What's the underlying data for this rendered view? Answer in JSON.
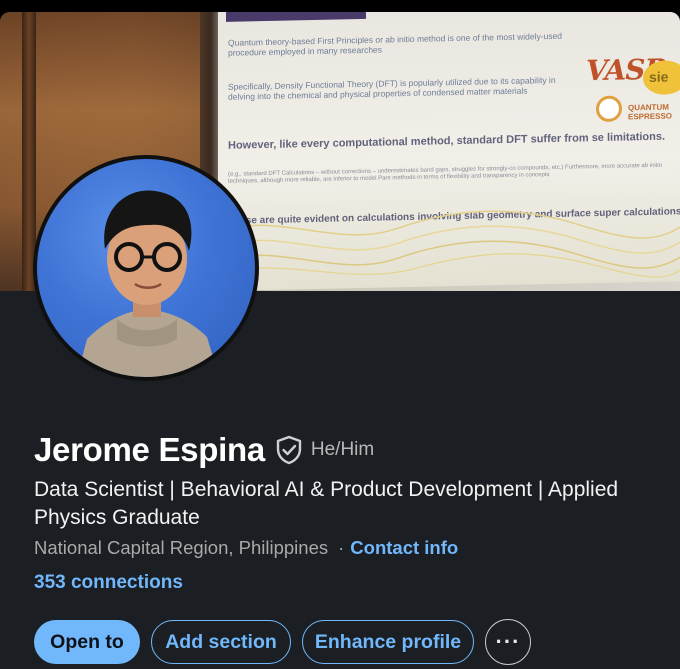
{
  "profile": {
    "name": "Jerome Espina",
    "pronouns": "He/Him",
    "headline": "Data Scientist | Behavioral AI & Product Development | Applied Physics Graduate",
    "location": "National Capital Region, Philippines",
    "separator": "·",
    "contact_info_label": "Contact info",
    "connections_label": "353 connections"
  },
  "banner_slide": {
    "line1": "Quantum theory-based First Principles or ab initio method is one of the most widely-used procedure employed in many researches",
    "line2": "Specifically, Density Functional Theory (DFT) is popularly utilized due to its capability in delving into the chemical and physical properties of condensed matter materials",
    "line3": "However, like every computational method, standard DFT suffer from se limitations.",
    "line4": "(e.g., standard DFT Calculations – without corrections – underestimates band gaps, struggles for strongly-co compounds, etc.) Furthermore, more accurate ab initio techniques, although more reliable, are inferior to model Pare methods in terms of flexibility and transparency in concepts",
    "line5": "These are quite evident on calculations involving slab geometry and surface super calculations",
    "logo1": "VASP",
    "logo2": "sie",
    "logo3": "QUANTUM ESPRESSO"
  },
  "actions": {
    "open_to": "Open to",
    "add_section": "Add section",
    "enhance_profile": "Enhance profile",
    "more": "···"
  },
  "colors": {
    "card_bg": "#1b1f23",
    "accent": "#71b7fb",
    "name": "#ffffff",
    "muted": "#a9a9a9"
  },
  "icons": {
    "verification": "shield-check-icon",
    "more": "ellipsis-icon"
  }
}
